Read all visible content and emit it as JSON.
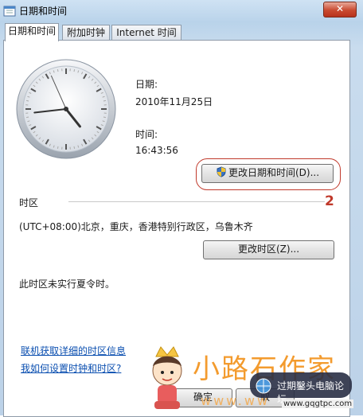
{
  "window": {
    "title": "日期和时间"
  },
  "tabs": [
    {
      "label": "日期和时间",
      "active": true
    },
    {
      "label": "附加时钟",
      "active": false
    },
    {
      "label": "Internet 时间",
      "active": false
    }
  ],
  "clock": {
    "time": "16:43:56"
  },
  "date_section": {
    "label": "日期:",
    "value": "2010年11月25日"
  },
  "time_section": {
    "label": "时间:",
    "value": "16:43:56"
  },
  "change_datetime_button": "更改日期和时间(D)...",
  "annotation_number": "2",
  "timezone": {
    "heading": "时区",
    "value": "(UTC+08:00)北京，重庆，香港特别行政区，乌鲁木齐",
    "change_button": "更改时区(Z)...",
    "dst_note": "此时区未实行夏令时。"
  },
  "links": {
    "timezone_info": "联机获取详细的时区信息",
    "how_to_set": "我如何设置时钟和时区?"
  },
  "buttons": {
    "ok": "确定",
    "cancel": "取"
  },
  "watermark": {
    "text": "小路石作家",
    "badge": "过期鑿头电脑论坛",
    "badge_url": "www.gqgtpc.com",
    "url": "www.ww"
  }
}
